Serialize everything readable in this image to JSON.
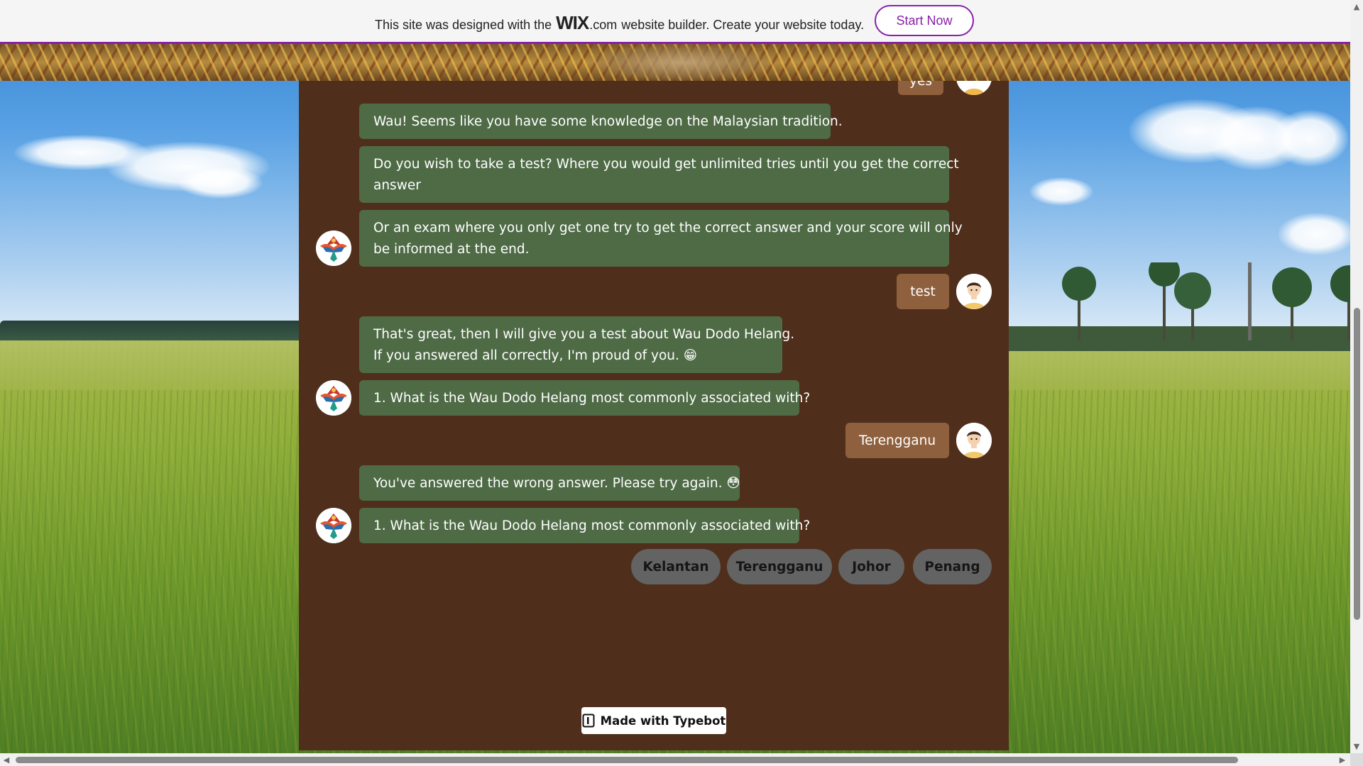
{
  "wix_banner": {
    "text_before": "This site was designed with the",
    "logo": "WIX",
    "dotcom": ".com",
    "text_after": "website builder. Create your website today.",
    "cta_label": "Start Now",
    "accent_color": "#8a1fa8"
  },
  "chat": {
    "panel_color": "#4f2e1b",
    "bot_bubble_color": "#4f6b46",
    "user_bubble_color": "#8f603d",
    "bot_avatar_icon": "kite-bird-avatar-icon",
    "user_avatar_icon": "boy-avatar-icon",
    "partial_user_reply": "yes",
    "messages": [
      {
        "from": "bot",
        "text": "Wau! Seems like you have some knowledge on the Malaysian tradition."
      },
      {
        "from": "bot",
        "lines": [
          "Do you wish to take a test? Where you would get unlimited tries until you get the correct",
          "answer"
        ]
      },
      {
        "from": "bot",
        "lines": [
          "Or an exam where you only get one try to get the correct answer and your score will only",
          "be informed at the end."
        ]
      },
      {
        "from": "user",
        "text": "test"
      },
      {
        "from": "bot",
        "lines": [
          "That's great, then I will give you a test about Wau Dodo Helang.",
          "If you answered all correctly, I'm proud of you."
        ],
        "emoji": "😁"
      },
      {
        "from": "bot",
        "text": "1. What is the Wau Dodo Helang most commonly associated with?"
      },
      {
        "from": "user",
        "text": "Terengganu"
      },
      {
        "from": "bot",
        "text": "You've answered the wrong answer. Please try again.",
        "emoji": "😳"
      },
      {
        "from": "bot",
        "text": "1. What is the Wau Dodo Helang most commonly associated with?"
      }
    ],
    "choices": [
      "Kelantan",
      "Terengganu",
      "Johor",
      "Penang"
    ],
    "badge_label": "Made with Typebot"
  },
  "icons": {
    "scroll_up": "▲",
    "scroll_down": "▼",
    "scroll_left": "◀",
    "scroll_right": "▶"
  }
}
